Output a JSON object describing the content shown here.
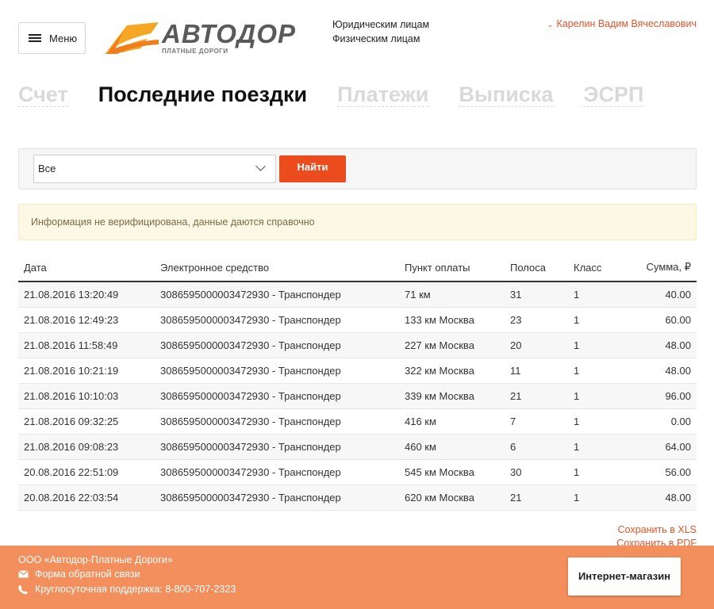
{
  "header": {
    "menu_label": "Меню",
    "logo_text": "АВТОДОР",
    "logo_subtitle": "ПЛАТНЫЕ ДОРОГИ",
    "legal_links": [
      "Юридическим лицам",
      "Физическим лицам"
    ],
    "user_name": "Карелин Вадим Вячеславович"
  },
  "tabs": [
    {
      "label": "Счет",
      "active": false
    },
    {
      "label": "Последние поездки",
      "active": true
    },
    {
      "label": "Платежи",
      "active": false
    },
    {
      "label": "Выписка",
      "active": false
    },
    {
      "label": "ЭСРП",
      "active": false
    }
  ],
  "filter": {
    "select_value": "Все",
    "find_label": "Найти"
  },
  "notice": "Информация не верифицирована, данные даются справочно",
  "table": {
    "columns": [
      "Дата",
      "Электронное средство",
      "Пункт оплаты",
      "Полоса",
      "Класс",
      "Сумма, ₽"
    ],
    "rows": [
      [
        "21.08.2016 13:20:49",
        "3086595000003472930 - Транспондер",
        "71 км",
        "31",
        "1",
        "40.00"
      ],
      [
        "21.08.2016 12:49:23",
        "3086595000003472930 - Транспондер",
        "133 км Москва",
        "23",
        "1",
        "60.00"
      ],
      [
        "21.08.2016 11:58:49",
        "3086595000003472930 - Транспондер",
        "227 км Москва",
        "20",
        "1",
        "48.00"
      ],
      [
        "21.08.2016 10:21:19",
        "3086595000003472930 - Транспондер",
        "322 км Москва",
        "11",
        "1",
        "48.00"
      ],
      [
        "21.08.2016 10:10:03",
        "3086595000003472930 - Транспондер",
        "339 км Москва",
        "21",
        "1",
        "96.00"
      ],
      [
        "21.08.2016 09:32:25",
        "3086595000003472930 - Транспондер",
        "416 км",
        "7",
        "1",
        "0.00"
      ],
      [
        "21.08.2016 09:08:23",
        "3086595000003472930 - Транспондер",
        "460 км",
        "6",
        "1",
        "64.00"
      ],
      [
        "20.08.2016 22:51:09",
        "3086595000003472930 - Транспондер",
        "545 км Москва",
        "30",
        "1",
        "56.00"
      ],
      [
        "20.08.2016 22:03:54",
        "3086595000003472930 - Транспондер",
        "620 км Москва",
        "21",
        "1",
        "48.00"
      ]
    ]
  },
  "save_links": [
    "Сохранить в XLS",
    "Сохранить в PDF"
  ],
  "footer": {
    "company": "ООО «Автодор-Платные Дороги»",
    "feedback": "Форма обратной связи",
    "support": "Круглосуточная поддержка: 8-800-707-2323",
    "shop_button": "Интернет-магазин"
  },
  "colors": {
    "accent": "#eb4b1d",
    "link": "#e2542a",
    "footer": "#f28f5c",
    "notice_bg": "#fcf8e3"
  },
  "icons": {
    "menu": "hamburger-icon",
    "dropdown": "chevron-down-icon",
    "user": "chevron-down-icon",
    "feedback": "envelope-icon",
    "support": "phone-icon"
  }
}
